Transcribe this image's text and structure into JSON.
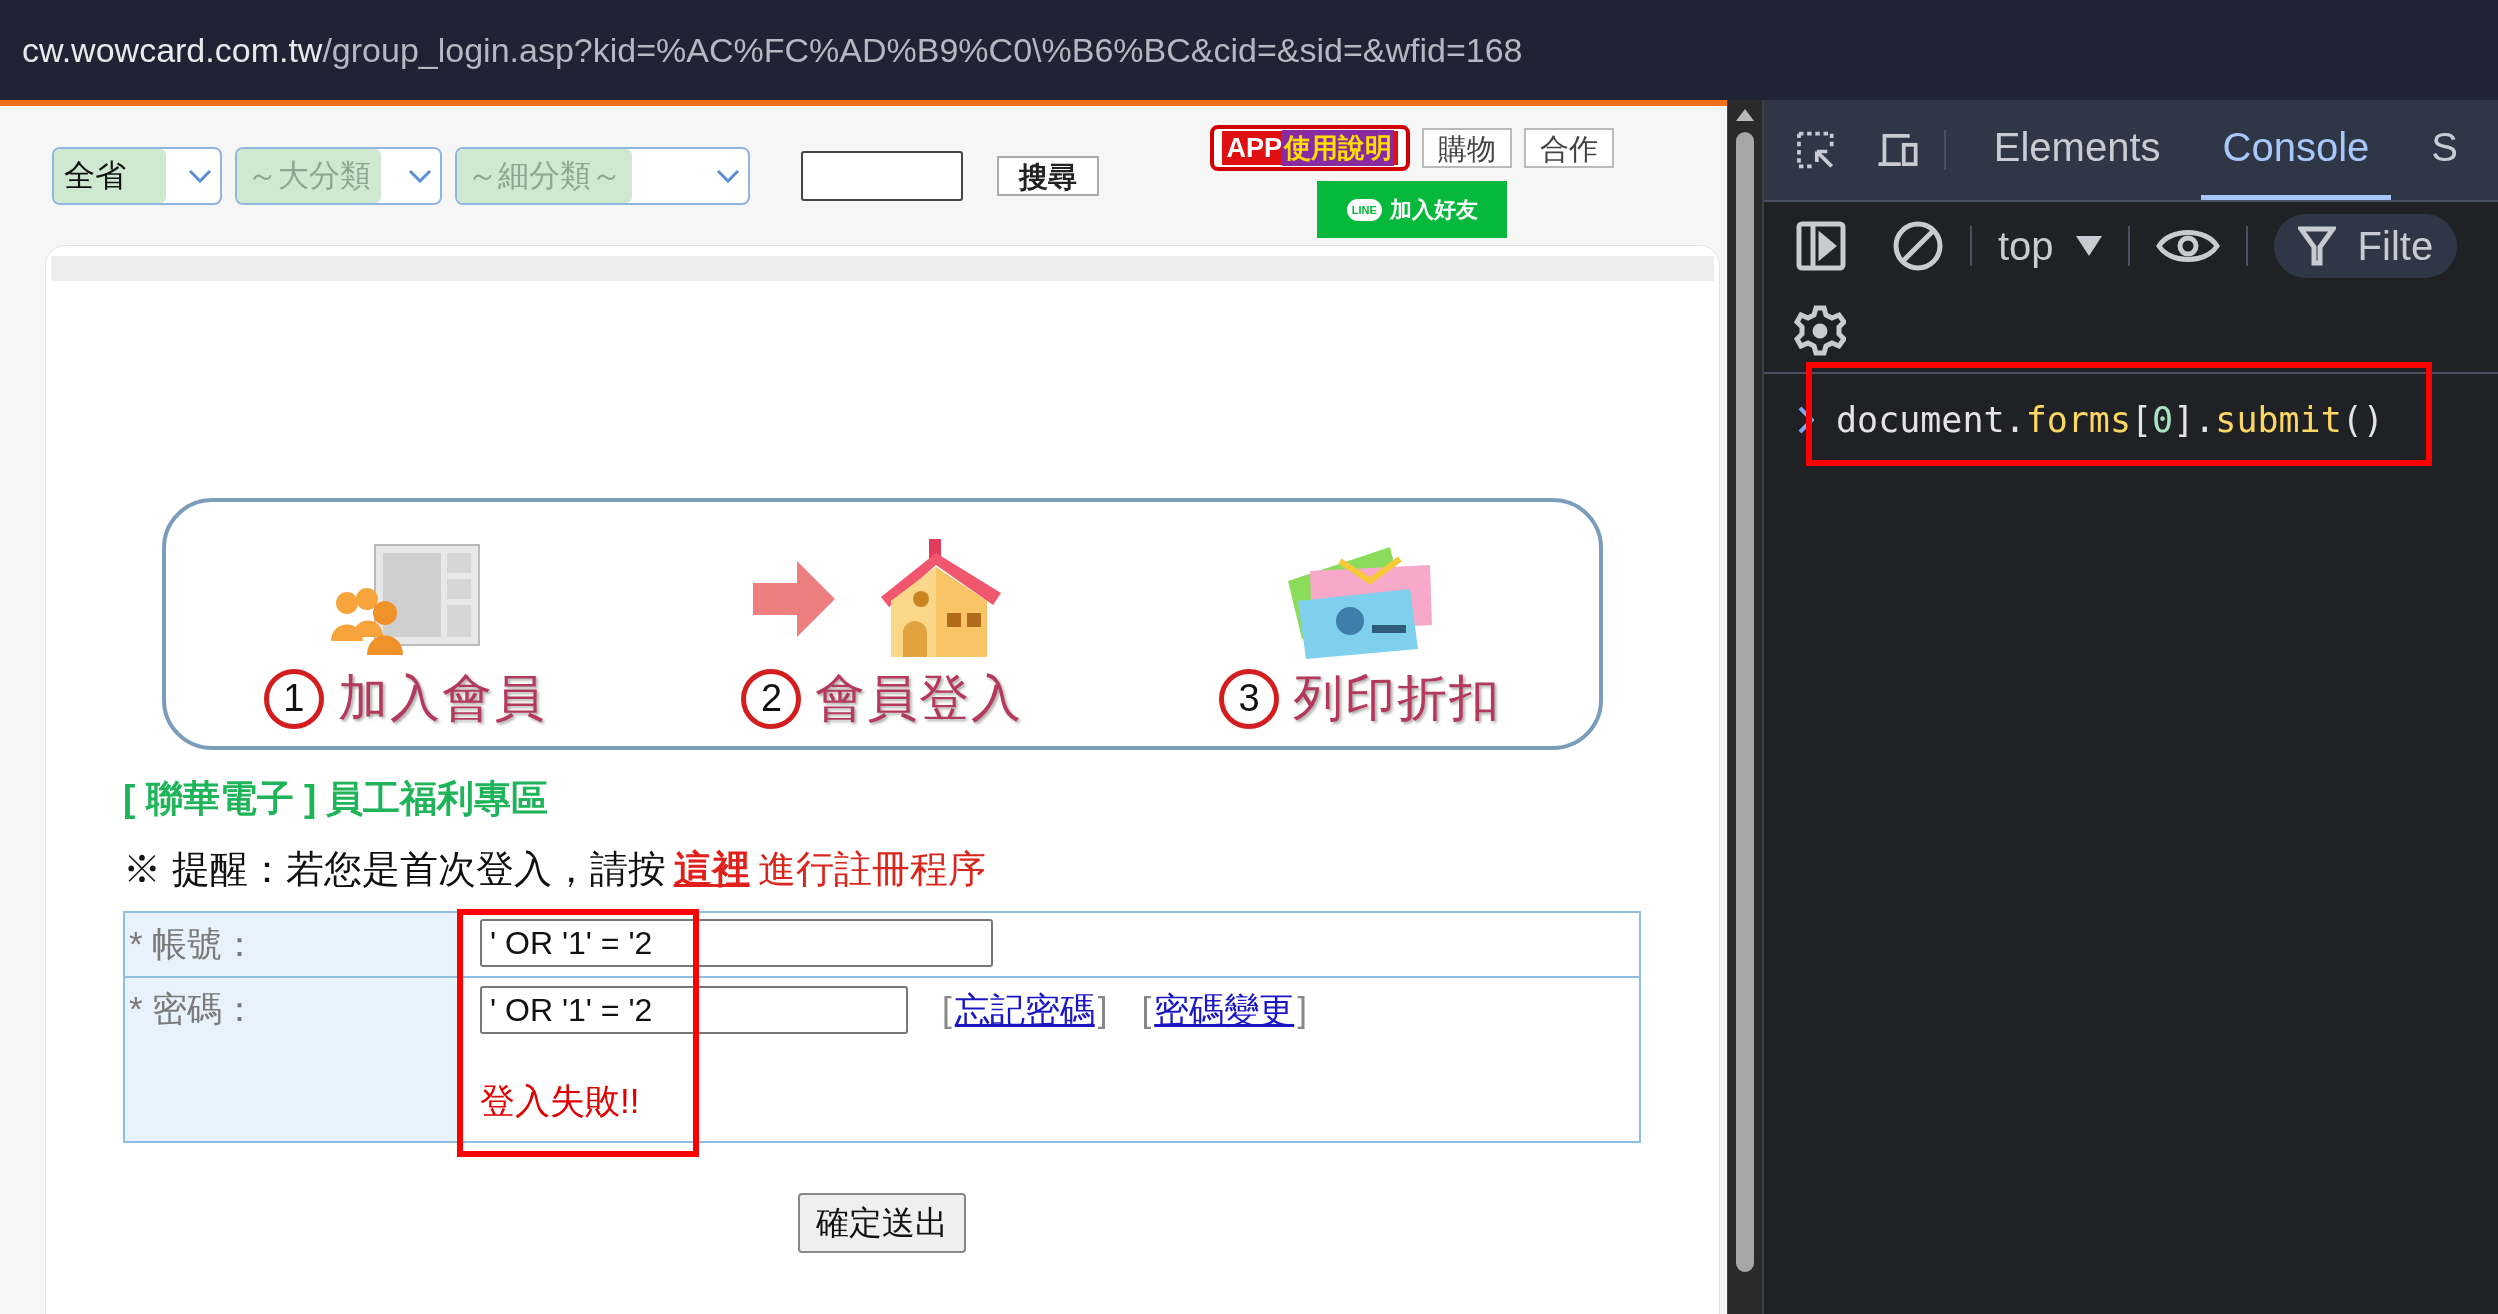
{
  "browser": {
    "url_host": "cw.wowcard.com.tw",
    "url_path": "/group_login.asp?kid=%AC%FC%AD%B9%C0\\%B6%BC&cid=&sid=&wfid=168"
  },
  "site_toolbar": {
    "selects": [
      {
        "value": "全省",
        "kind": "region"
      },
      {
        "value": "～大分類",
        "kind": "category"
      },
      {
        "value": "～細分類～",
        "kind": "category"
      }
    ],
    "search_button": "搜尋",
    "app_button": {
      "tag": "APP",
      "label": "使用說明"
    },
    "links": [
      "購物",
      "合作"
    ],
    "line_button": {
      "badge": "LINE",
      "label": "加入好友"
    }
  },
  "steps": [
    {
      "number": "1",
      "label": "加入會員",
      "kind": "members"
    },
    {
      "number": "2",
      "label": "會員登入",
      "kind": "house"
    },
    {
      "number": "3",
      "label": "列印折扣",
      "kind": "cards"
    }
  ],
  "section_title": "[ 聯華電子 ] 員工福利專區",
  "reminder": {
    "text": "※ 提醒：若您是首次登入，請按",
    "link": "這裡",
    "after": "進行註冊程序"
  },
  "login_form": {
    "highlighted": true,
    "account": {
      "label": "* 帳號：",
      "value": "' OR '1' = '2"
    },
    "password": {
      "label": "* 密碼：",
      "value": "' OR '1' = '2",
      "links": [
        {
          "open": "[",
          "text": "忘記密碼",
          "close": "]"
        },
        {
          "open": "[",
          "text": "密碼變更",
          "close": "]"
        }
      ]
    },
    "error": "登入失敗!!",
    "submit": "確定送出"
  },
  "devtools": {
    "tabs": [
      {
        "label": "Elements",
        "selected": false
      },
      {
        "label": "Console",
        "selected": true
      },
      {
        "label": "S",
        "selected": false
      }
    ],
    "context": "top",
    "filter": "Filte",
    "console_entry": {
      "highlighted": true,
      "tokens": [
        {
          "text": "document.",
          "kind": "plain"
        },
        {
          "text": "forms",
          "kind": "property"
        },
        {
          "text": "[",
          "kind": "plain"
        },
        {
          "text": "0",
          "kind": "number"
        },
        {
          "text": "].",
          "kind": "plain"
        },
        {
          "text": "submit",
          "kind": "property"
        },
        {
          "text": "()",
          "kind": "plain"
        }
      ]
    }
  }
}
